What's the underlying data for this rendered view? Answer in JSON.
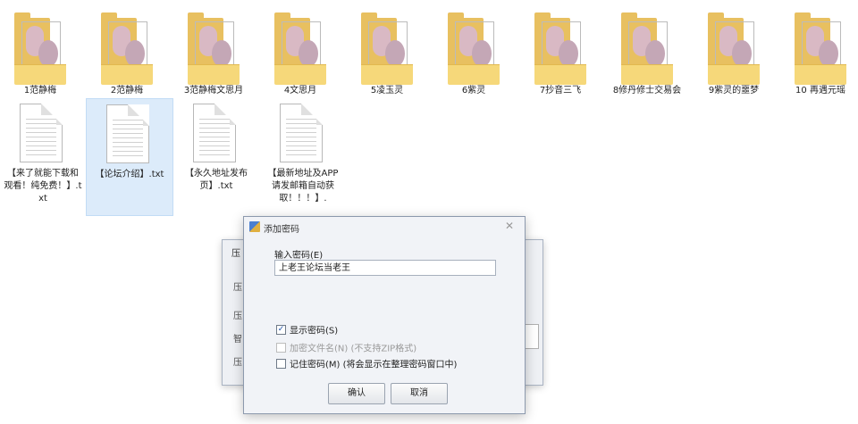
{
  "folders": [
    {
      "name": "1范静梅"
    },
    {
      "name": "2范静梅"
    },
    {
      "name": "3范静梅文思月"
    },
    {
      "name": "4文思月"
    },
    {
      "name": "5凌玉灵"
    },
    {
      "name": "6紫灵"
    },
    {
      "name": "7抄音三飞"
    },
    {
      "name": "8修丹修士交易会"
    },
    {
      "name": "9紫灵的噩梦"
    },
    {
      "name": "10 再遇元瑶"
    }
  ],
  "files": [
    {
      "name": "【来了就能下载和观看！纯免费！】.txt"
    },
    {
      "name": "【论坛介绍】.txt"
    },
    {
      "name": "【永久地址发布页】.txt"
    },
    {
      "name": "【最新地址及APP请发邮箱自动获取！！！】."
    }
  ],
  "dialog": {
    "title": "添加密码",
    "close": "✕",
    "input_label": "输入密码(E)",
    "password_value": "上老王论坛当老王",
    "options": [
      {
        "label": "显示密码(S)",
        "checked": true,
        "disabled": false,
        "check_mark": "✓"
      },
      {
        "label": "加密文件名(N) (不支持ZIP格式)",
        "checked": false,
        "disabled": true,
        "check_mark": ""
      },
      {
        "label": "记住密码(M) (将会显示在整理密码窗口中)",
        "checked": false,
        "disabled": false,
        "check_mark": ""
      }
    ],
    "ok": "确认",
    "cancel": "取消"
  },
  "background_dialog": {
    "title_fragment": "压",
    "left_chars": [
      "压",
      "压",
      "智",
      "压"
    ]
  }
}
